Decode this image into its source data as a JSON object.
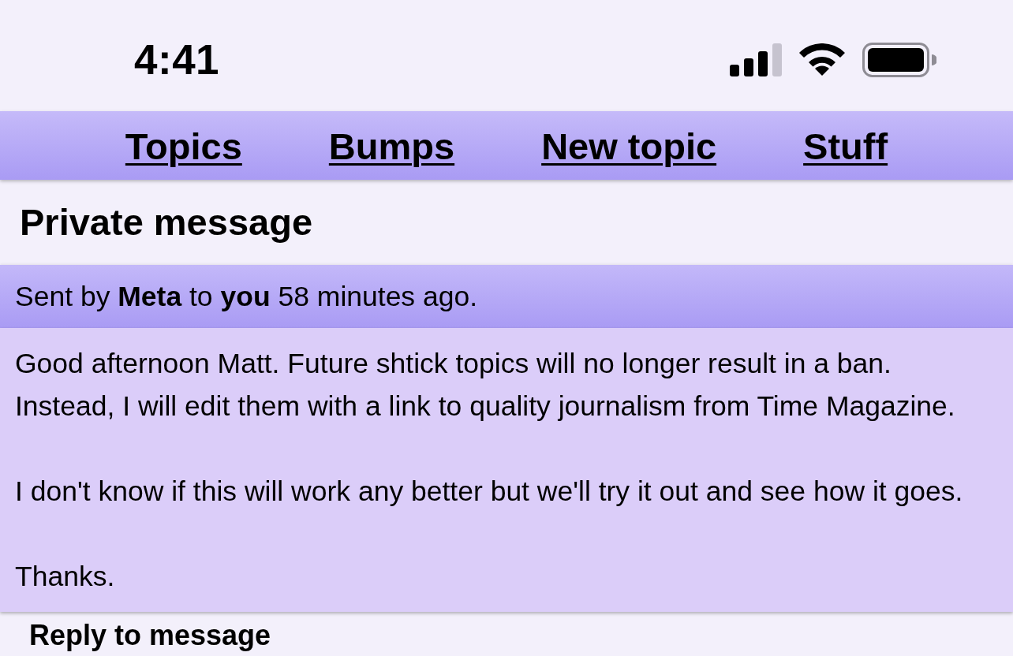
{
  "status_bar": {
    "time": "4:41"
  },
  "nav": {
    "links": [
      "Topics",
      "Bumps",
      "New topic",
      "Stuff"
    ]
  },
  "page_title": "Private message",
  "message": {
    "meta": "Sent by **Meta** to **you** 58 minutes ago.",
    "paragraphs": [
      "Good afternoon Matt. Future shtick topics will no longer result in a ban. Instead, I will edit them with a link to quality journalism from Time Magazine.",
      "I don't know if this will work any better but we'll try it out and see how it goes.",
      "Thanks."
    ]
  },
  "reply": {
    "heading": "Reply to message"
  }
}
